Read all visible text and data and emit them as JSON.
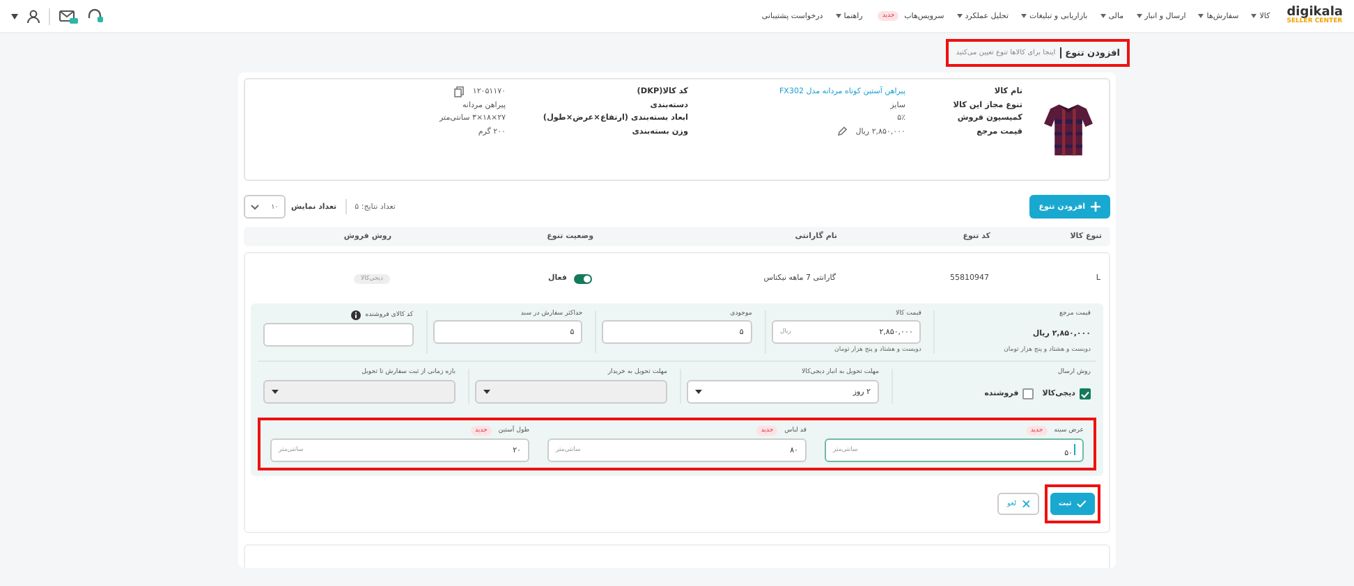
{
  "logo": {
    "name": "digikala",
    "subtitle": "SELLER CENTER"
  },
  "nav": [
    {
      "label": "کالا",
      "caret": true
    },
    {
      "label": "سفارش‌ها",
      "caret": true
    },
    {
      "label": "ارسال و انبار",
      "caret": true
    },
    {
      "label": "مالی",
      "caret": true
    },
    {
      "label": "بازاریابی و تبلیغات",
      "caret": true
    },
    {
      "label": "تحلیل عملکرد",
      "caret": true
    },
    {
      "label": "سرویس‌هاب",
      "caret": false,
      "badge": "جدید"
    },
    {
      "label": "راهنما",
      "caret": true
    },
    {
      "label": "درخواست پشتیبانی",
      "caret": false
    }
  ],
  "page": {
    "title": "افزودن تنوع",
    "subtitle": "اینجا برای کالاها تنوع تعیین می‌کنید"
  },
  "product": {
    "kind": "picture",
    "fields": [
      {
        "label": "نام کالا",
        "value": "پیراهن آستین کوتاه مردانه مدل FX302",
        "kind": "link"
      },
      {
        "label": "کد کالا(DKP)",
        "value": "۱۲۰۵۱۱۷۰",
        "kind": "copy"
      },
      {
        "label": "تنوع مجاز این کالا",
        "value": "سایز",
        "kind": "text"
      },
      {
        "label": "دسته‌بندی",
        "value": "پیراهن مردانه",
        "kind": "text"
      },
      {
        "label": "کمیسیون فروش",
        "value": "۵٪",
        "kind": "text"
      },
      {
        "label": "ابعاد بسته‌بندی (ارتفاع×عرض×طول)",
        "value": "۲۷×۱۸×۳ سانتی‌متر",
        "kind": "text"
      },
      {
        "label": "قیمت مرجع",
        "value": "۲,۸۵۰,۰۰۰ ریال",
        "kind": "edit"
      },
      {
        "label": "وزن بسته‌بندی",
        "value": "۲۰۰ گرم",
        "kind": "text"
      }
    ]
  },
  "toolbar": {
    "add_button": "افزودن تنوع",
    "results": "تعداد نتایج: ۵",
    "page_size_label": "تعداد نمایش",
    "page_size": "۱۰"
  },
  "table": {
    "columns": [
      "تنوع کالا",
      "کد تنوع",
      "نام گارانتی",
      "وضعیت تنوع",
      "روش فروش"
    ],
    "row": {
      "variant": "L",
      "code": "55810947",
      "warranty": "گارانتی 7 ماهه نیکتاس",
      "active": true,
      "status": "فعال",
      "sale_method": "دیجی‌کالا"
    }
  },
  "form": {
    "reference_price": {
      "label": "قیمت مرجع",
      "value": "۲,۸۵۰,۰۰۰ ریال",
      "words": "دویست و هشتاد و پنج هزار تومان"
    },
    "inputs": [
      {
        "label": "قیمت کالا",
        "value": "۲,۸۵۰,۰۰۰",
        "unit": "ریال",
        "help": "دویست و هشتاد و پنج هزار تومان",
        "info": false
      },
      {
        "label": "موجودی",
        "value": "۵",
        "info": false
      },
      {
        "label": "حداکثر سفارش در سبد",
        "value": "۵",
        "info": false
      },
      {
        "label": "کد کالای فروشنده",
        "info": true
      }
    ],
    "shipping": {
      "label": "روش ارسال",
      "options": [
        {
          "label": "دیجی‌کالا",
          "checked": true
        },
        {
          "label": "فروشنده",
          "checked": false
        }
      ]
    },
    "selects": [
      {
        "label": "مهلت تحویل به انبار دیجی‌کالا",
        "value": "۲ روز",
        "disabled": false
      },
      {
        "label": "مهلت تحویل به خریدار",
        "disabled": true
      },
      {
        "label": "بازه زمانی از ثبت سفارش تا تحویل",
        "disabled": true
      }
    ],
    "sizes": [
      {
        "label": "عرض سینه",
        "badge": "جدید",
        "value": "۵۰",
        "unit": "سانتی‌متر",
        "focused": true
      },
      {
        "label": "قد لباس",
        "badge": "جدید",
        "value": "۸۰",
        "unit": "سانتی‌متر",
        "focused": false
      },
      {
        "label": "طول آستین",
        "badge": "جدید",
        "value": "۲۰",
        "unit": "سانتی‌متر",
        "focused": false
      }
    ],
    "submit": "ثبت",
    "cancel": "لغو"
  }
}
